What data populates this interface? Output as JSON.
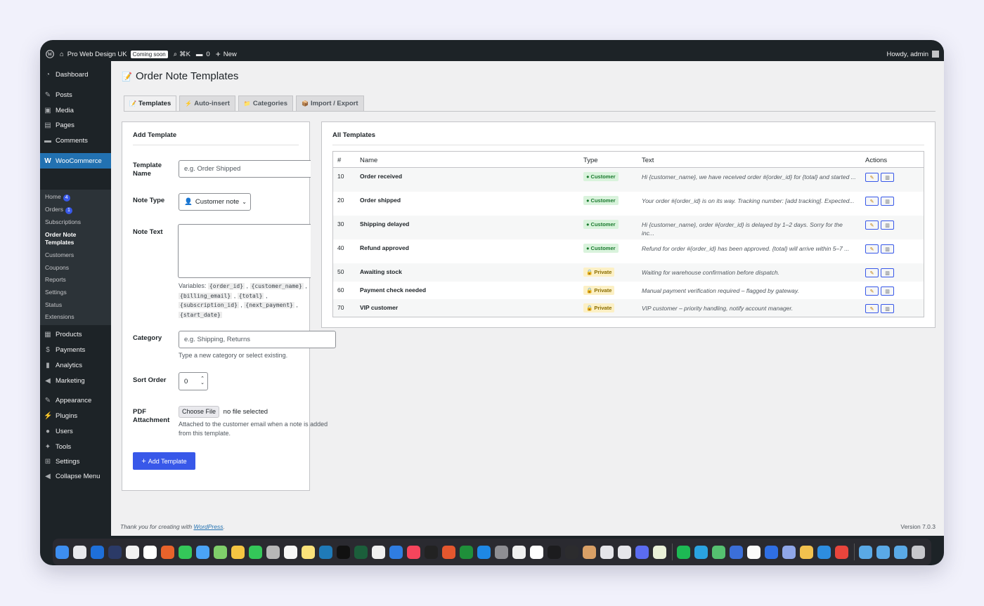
{
  "adminbar": {
    "site_name": "Pro Web Design UK",
    "coming_soon": "Coming soon",
    "shortcut": "⌘K",
    "comments_count": "0",
    "new_label": "New",
    "greeting": "Howdy, admin"
  },
  "sidebar": {
    "dashboard": "Dashboard",
    "posts": "Posts",
    "media": "Media",
    "pages": "Pages",
    "comments": "Comments",
    "woocommerce": "WooCommerce",
    "sub": {
      "home": "Home",
      "home_count": "4",
      "orders": "Orders",
      "orders_count": "1",
      "subscriptions": "Subscriptions",
      "order_note_templates_1": "Order Note",
      "order_note_templates_2": "Templates",
      "customers": "Customers",
      "coupons": "Coupons",
      "reports": "Reports",
      "settings": "Settings",
      "status": "Status",
      "extensions": "Extensions"
    },
    "products": "Products",
    "payments": "Payments",
    "analytics": "Analytics",
    "marketing": "Marketing",
    "appearance": "Appearance",
    "plugins": "Plugins",
    "users": "Users",
    "tools": "Tools",
    "settings": "Settings",
    "collapse": "Collapse Menu"
  },
  "page": {
    "title": "Order Note Templates",
    "tabs": [
      "Templates",
      "Auto-insert",
      "Categories",
      "Import / Export"
    ]
  },
  "form": {
    "title": "Add Template",
    "name_label": "Template Name",
    "name_placeholder": "e.g. Order Shipped",
    "type_label": "Note Type",
    "type_value": "Customer note",
    "text_label": "Note Text",
    "variables_prefix": "Variables:",
    "variables": [
      "{order_id}",
      "{customer_name}",
      "{billing_email}",
      "{total}",
      "{subscription_id}",
      "{next_payment}",
      "{start_date}"
    ],
    "category_label": "Category",
    "category_placeholder": "e.g. Shipping, Returns",
    "category_help": "Type a new category or select existing.",
    "sort_label": "Sort Order",
    "sort_value": "0",
    "pdf_label": "PDF Attachment",
    "choose_file": "Choose File",
    "no_file": "no file selected",
    "pdf_help": "Attached to the customer email when a note is added from this template.",
    "submit": "Add Template"
  },
  "table": {
    "title": "All Templates",
    "headers": [
      "#",
      "Name",
      "Type",
      "Text",
      "Actions"
    ],
    "rows": [
      {
        "num": "10",
        "name": "Order received",
        "type": "Customer",
        "text": "Hi {customer_name}, we have received order #{order_id} for {total} and started ..."
      },
      {
        "num": "20",
        "name": "Order shipped",
        "type": "Customer",
        "text": "Your order #{order_id} is on its way. Tracking number: [add tracking]. Expected..."
      },
      {
        "num": "30",
        "name": "Shipping delayed",
        "type": "Customer",
        "text": "Hi {customer_name}, order #{order_id} is delayed by 1–2 days. Sorry for the inc..."
      },
      {
        "num": "40",
        "name": "Refund approved",
        "type": "Customer",
        "text": "Refund for order #{order_id} has been approved. {total} will arrive within 5–7 ..."
      },
      {
        "num": "50",
        "name": "Awaiting stock",
        "type": "Private",
        "text": "Waiting for warehouse confirmation before dispatch."
      },
      {
        "num": "60",
        "name": "Payment check needed",
        "type": "Private",
        "text": "Manual payment verification required – flagged by gateway."
      },
      {
        "num": "70",
        "name": "VIP customer",
        "type": "Private",
        "text": "VIP customer – priority handling, notify account manager."
      }
    ]
  },
  "footer": {
    "thanks_prefix": "Thank you for creating with",
    "thanks_link": "WordPress",
    "version": "Version 7.0.3"
  },
  "colors": {
    "accent": "#3858e9",
    "admin_dark": "#1d2327",
    "customer_pill": "#d9f3dc",
    "private_pill": "#fcf0c5"
  }
}
